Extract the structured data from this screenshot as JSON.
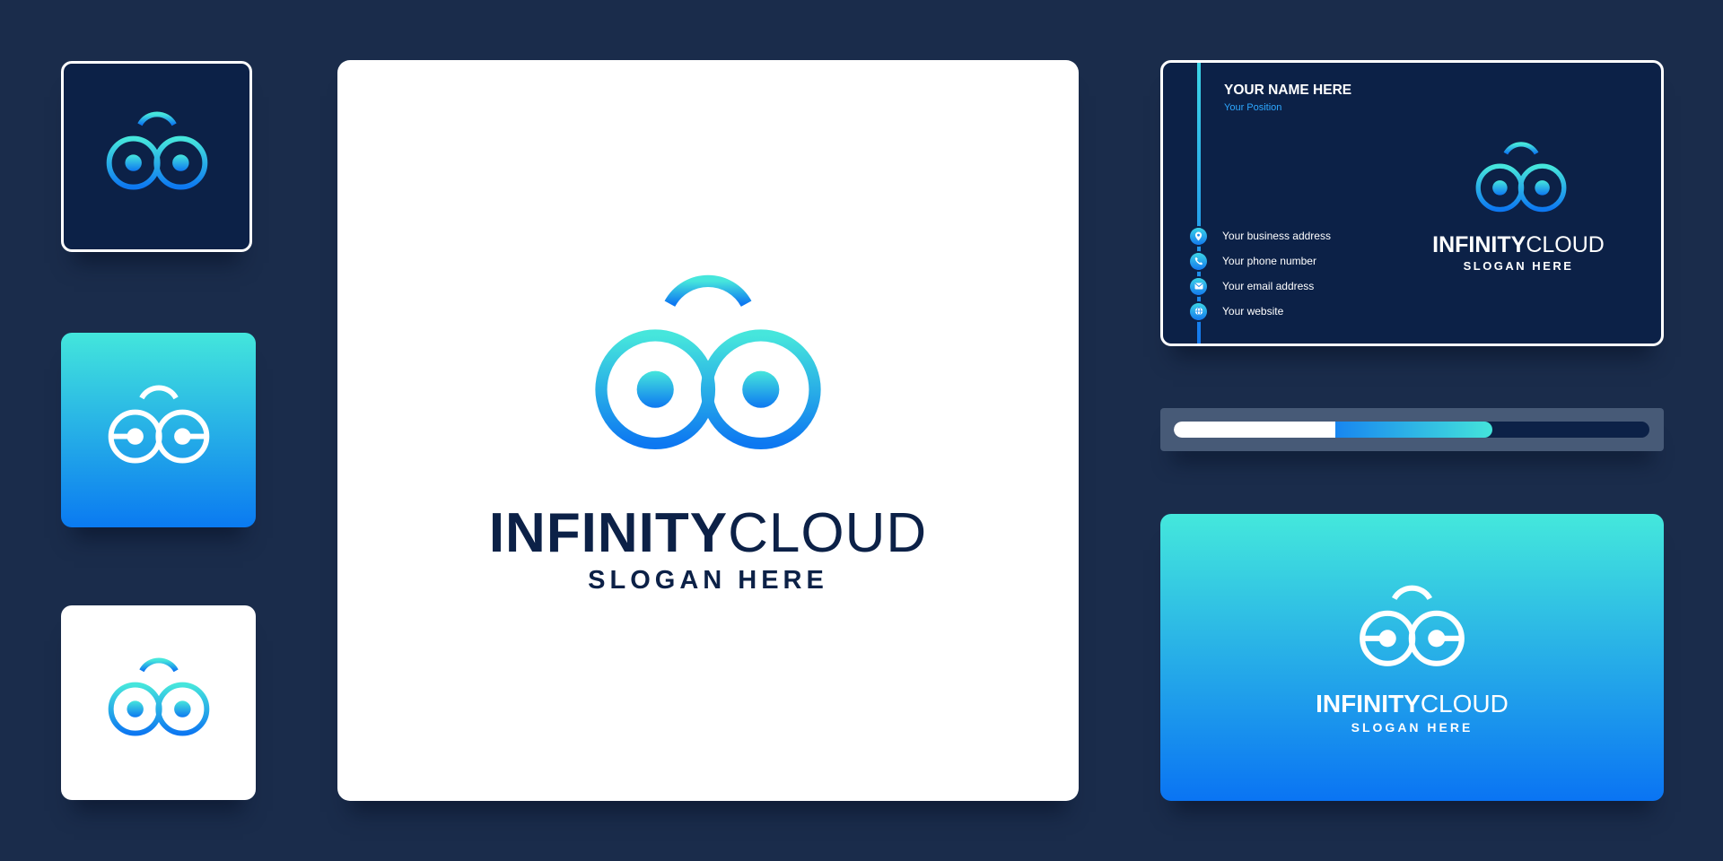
{
  "brand": {
    "name_bold": "INFINITY",
    "name_light": "CLOUD",
    "slogan": "SLOGAN HERE"
  },
  "business_card": {
    "name": "YOUR NAME HERE",
    "position": "Your Position",
    "contacts": [
      {
        "label": "Your business address",
        "icon": "location-pin-icon"
      },
      {
        "label": "Your phone number",
        "icon": "phone-icon"
      },
      {
        "label": "Your email address",
        "icon": "email-icon"
      },
      {
        "label": "Your website",
        "icon": "globe-icon"
      }
    ]
  },
  "progress": {
    "white_fraction": 0.34,
    "total_fraction": 0.67
  },
  "colors": {
    "background": "#1a2c4b",
    "navy": "#0c2147",
    "gradient_top": "#44e8dc",
    "gradient_bottom": "#0a74f3",
    "accent": "#2ea7ff",
    "white": "#ffffff"
  }
}
